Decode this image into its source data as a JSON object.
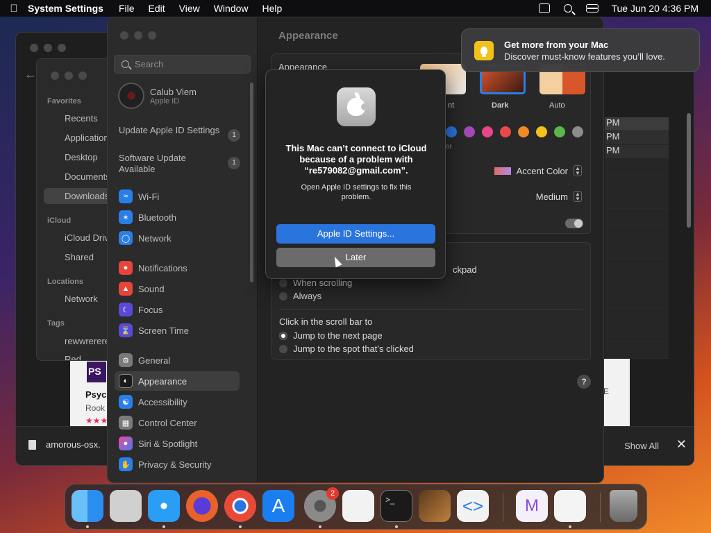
{
  "menubar": {
    "app_name": "System Settings",
    "menus": [
      "File",
      "Edit",
      "View",
      "Window",
      "Help"
    ],
    "datetime": "Tue Jun 20  4:36 PM"
  },
  "finder": {
    "sidebar": {
      "favorites_label": "Favorites",
      "favorites": [
        "Recents",
        "Applications",
        "Desktop",
        "Documents",
        "Downloads"
      ],
      "icloud_label": "iCloud",
      "icloud": [
        "iCloud Drive",
        "Shared"
      ],
      "locations_label": "Locations",
      "locations": [
        "Network"
      ],
      "tags_label": "Tags",
      "tags": [
        "rewwrerere",
        "Red"
      ]
    },
    "times": [
      "PM",
      "PM",
      "PM"
    ],
    "download_file": "amorous-osx.",
    "show_all": "Show All",
    "web": {
      "logo": "PS",
      "title": "Psyc",
      "sub": "Rook",
      "stars": "★★★",
      "e": "E"
    }
  },
  "settings": {
    "search_placeholder": "Search",
    "user": {
      "name": "Calub Viem",
      "sub": "Apple ID"
    },
    "updates": [
      {
        "label": "Update Apple ID Settings",
        "count": "1"
      },
      {
        "label": "Software Update Available",
        "count": "1"
      }
    ],
    "nav": [
      "Wi-Fi",
      "Bluetooth",
      "Network",
      "Notifications",
      "Sound",
      "Focus",
      "Screen Time",
      "General",
      "Appearance",
      "Accessibility",
      "Control Center",
      "Siri & Spotlight",
      "Privacy & Security"
    ],
    "page_title": "Appearance",
    "appearance_label": "Appearance",
    "modes": [
      "nt",
      "Dark",
      "Auto"
    ],
    "accent_fragment": "or",
    "highlight_label": "Accent Color",
    "size_value": "Medium",
    "trackpad_fragment": "ckpad",
    "scroll_options": [
      "When scrolling",
      "Always"
    ],
    "click_label": "Click in the scroll bar to",
    "click_options": [
      "Jump to the next page",
      "Jump to the spot that’s clicked"
    ],
    "help": "?"
  },
  "dialog": {
    "title": "This Mac can’t connect to iCloud because of a problem with “re579082@gmail.com”.",
    "message": "Open Apple ID settings to fix this problem.",
    "primary": "Apple ID Settings...",
    "secondary": "Later"
  },
  "notification": {
    "title": "Get more from your Mac",
    "subtitle": "Discover must-know features you’ll love."
  },
  "dock": {
    "settings_badge": "2",
    "colors": {
      "finder": "#2a8ef0",
      "launchpad": "#d0d0d0",
      "safari": "#2a9ef5",
      "firefox": "#e8622a",
      "chrome": "#e8e8e8",
      "appstore": "#1a7ef0",
      "settings": "#8a8a8a",
      "textedit": "#f2f2f2",
      "terminal": "#1a1a1a",
      "garageband": "#3a2a1a",
      "vscode": "#f2f2f2",
      "vs": "#f4f0fa",
      "freeform": "#f4f4f4",
      "trash": "#8a8a8a"
    }
  }
}
